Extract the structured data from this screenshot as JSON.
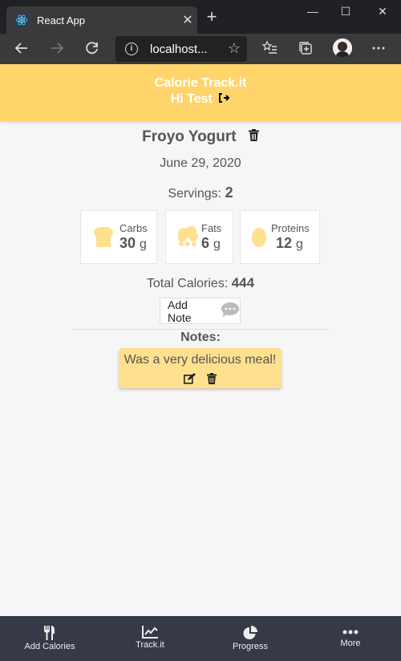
{
  "browser": {
    "tab_title": "React App",
    "tab_close": "✕",
    "new_tab": "+",
    "url": "localhost...",
    "minimize": "—",
    "maximize": "☐",
    "close": "✕"
  },
  "header": {
    "app_title": "Calorie Track.it",
    "greeting": "Hi Test"
  },
  "food": {
    "name": "Froyo Yogurt",
    "date": "June 29, 2020",
    "servings_label": "Servings:",
    "servings_value": "2"
  },
  "macros": [
    {
      "label": "Carbs",
      "value": "30",
      "unit": "g",
      "icon": "bread-icon"
    },
    {
      "label": "Fats",
      "value": "6",
      "unit": "g",
      "icon": "fat-cloud-icon"
    },
    {
      "label": "Proteins",
      "value": "12",
      "unit": "g",
      "icon": "egg-icon"
    }
  ],
  "total": {
    "label": "Total Calories:",
    "value": "444"
  },
  "add_note_label": "Add Note",
  "notes": {
    "heading": "Notes:",
    "items": [
      {
        "text": "Was a very delicious meal!"
      }
    ]
  },
  "bottom_nav": [
    {
      "label": "Add Calories",
      "icon": "utensils-icon"
    },
    {
      "label": "Track.it",
      "icon": "line-chart-icon"
    },
    {
      "label": "Progress",
      "icon": "pie-chart-icon"
    },
    {
      "label": "More",
      "icon": "more-dots-icon"
    }
  ],
  "colors": {
    "header_bg": "#ffd56b",
    "note_bg": "#ffe08f",
    "nav_bg": "#353a46",
    "macro_icon": "#ffe08f"
  }
}
